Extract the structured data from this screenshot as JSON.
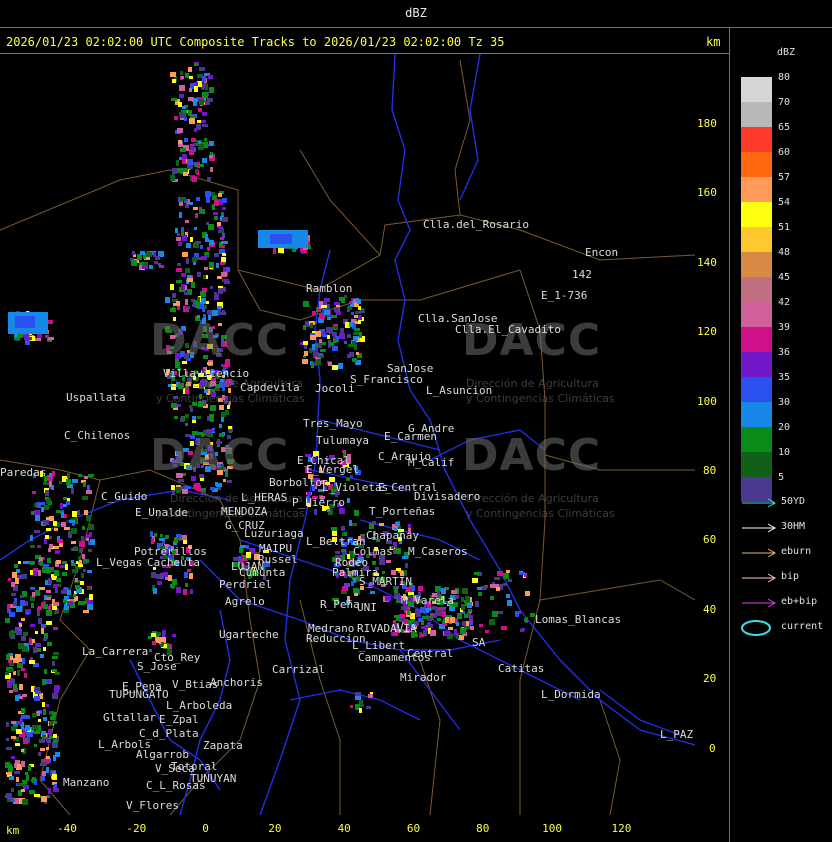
{
  "top_title": "dBZ",
  "header": "2026/01/23 02:02:00 UTC Composite Tracks to 2026/01/23 02:02:00 Tz 35",
  "km_label_top": "km",
  "km_label_bottom": "km",
  "y_ticks": [
    "180",
    "160",
    "140",
    "120",
    "100",
    "80",
    "60",
    "40",
    "20",
    "0"
  ],
  "x_ticks": [
    "-40",
    "-20",
    "0",
    "20",
    "40",
    "60",
    "80",
    "100",
    "120"
  ],
  "legend": {
    "title": "dBZ",
    "levels": [
      {
        "label": "80",
        "color": "#d6d6d6"
      },
      {
        "label": "70",
        "color": "#b8b8b8"
      },
      {
        "label": "65",
        "color": "#ff3a2a"
      },
      {
        "label": "60",
        "color": "#ff6a10"
      },
      {
        "label": "57",
        "color": "#ff9a5a"
      },
      {
        "label": "54",
        "color": "#ffff10"
      },
      {
        "label": "51",
        "color": "#ffc830"
      },
      {
        "label": "48",
        "color": "#d88a44"
      },
      {
        "label": "45",
        "color": "#c07080"
      },
      {
        "label": "42",
        "color": "#d0609a"
      },
      {
        "label": "39",
        "color": "#d0108a"
      },
      {
        "label": "36",
        "color": "#7018c8"
      },
      {
        "label": "35",
        "color": "#2a50f0"
      },
      {
        "label": "30",
        "color": "#1888e8"
      },
      {
        "label": "20",
        "color": "#0a8a18"
      },
      {
        "label": "10",
        "color": "#106018"
      },
      {
        "label": "5",
        "color": "#4a3890"
      }
    ],
    "tracks": [
      {
        "label": "50YD",
        "color": "#40e0e0"
      },
      {
        "label": "30HM",
        "color": "#ffffff"
      },
      {
        "label": "eburn",
        "color": "#e8b870"
      },
      {
        "label": "bip",
        "color": "#ffc8d0"
      },
      {
        "label": "eb+bip",
        "color": "#e040e0"
      }
    ],
    "current_label": "current",
    "current_color": "#40e0e0"
  },
  "watermark": {
    "big": "DACC",
    "line1": "Dirección de Agricultura",
    "line2": "y Contingencias Climáticas"
  },
  "places": [
    "Clla.del_Rosario",
    "Encon",
    "142",
    "E_1-736",
    "Ramblon",
    "Clla.SanJose",
    "Clla.El_Cavadito",
    "Villavicencio",
    "S_Francisco",
    "SanJose",
    "Capdevila",
    "Jocoli",
    "L_Asuncion",
    "Uspallata",
    "Tres_Mayo",
    "G_Andre",
    "C_Chilenos",
    "Tulumaya",
    "E_Carmen",
    "E_Chical",
    "C_Araujo",
    "M_Calif",
    "E_Vergel",
    "Borbollon",
    "L_Violetas",
    "E_Central",
    "Divisadero",
    "C_Guido",
    "L_HERAS",
    "P_Hierro",
    "MENDOZA",
    "T_Porteñas",
    "E_Unalde",
    "G_CRUZ",
    "Luzuriaga",
    "Chapanay",
    "L_Beltran",
    "MAIPU",
    "Colmas",
    "M_Caseros",
    "Potrerillos",
    "Russel",
    "Cacheuta",
    "L_Vegas",
    "LUJAN",
    "Rodeo",
    "Cumunta",
    "Palmira",
    "Perdriel",
    "S_MARTIN",
    "Agrelo",
    "R_Peña",
    "UNI",
    "M_Varela",
    "Lomas_Blancas",
    "Ugarteche",
    "Medrano",
    "Reduccion",
    "La_Carrera",
    "Cto_Rey",
    "RIVADAVIA",
    "S_Jose",
    "L_Libert",
    "Central",
    "Campamentos",
    "Carrizal",
    "Catitas",
    "E_Pena",
    "V_Btias",
    "Anchoris",
    "TUPUNGATO",
    "Mirador",
    "L_Dormida",
    "L_Arboleda",
    "Gltallar",
    "E_Zpal",
    "L_PAZ",
    "C_d_Plata",
    "L_Arbols",
    "Zapata",
    "Algarrob",
    "V_Seca",
    "Totoral",
    "TUNUYAN",
    "Manzano",
    "C_L_Rosas",
    "V_Flores",
    "Paredas",
    "SA"
  ]
}
